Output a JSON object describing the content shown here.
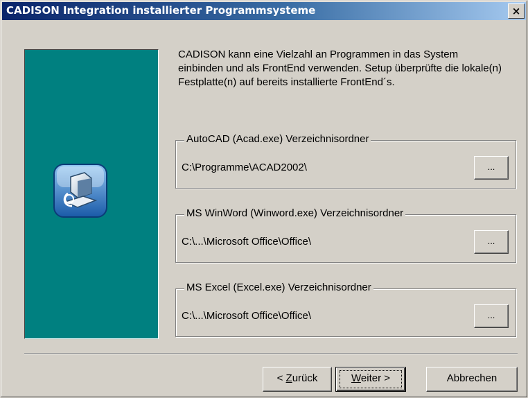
{
  "window": {
    "title": "CADISON Integration installierter Programmsysteme",
    "close_label": "×"
  },
  "side_panel": {
    "icon": "computer-install-icon",
    "color": "#008080"
  },
  "intro_text": "CADISON kann eine Vielzahl an Programmen in das System einbinden und als FrontEnd verwenden. Setup überprüfte die lokale(n) Festplatte(n) auf bereits installierte FrontEnd´s.",
  "groups": [
    {
      "legend": "AutoCAD (Acad.exe) Verzeichnisordner",
      "path": "C:\\Programme\\ACAD2002\\",
      "browse_label": "..."
    },
    {
      "legend": "MS WinWord (Winword.exe) Verzeichnisordner",
      "path": "C:\\...\\Microsoft Office\\Office\\",
      "browse_label": "..."
    },
    {
      "legend": "MS Excel (Excel.exe) Verzeichnisordner",
      "path": "C:\\...\\Microsoft Office\\Office\\",
      "browse_label": "..."
    }
  ],
  "buttons": {
    "back": {
      "pre": "< ",
      "mnemonic": "Z",
      "post": "urück"
    },
    "next": {
      "mnemonic": "W",
      "post": "eiter >"
    },
    "cancel": {
      "label": "Abbrechen"
    }
  }
}
